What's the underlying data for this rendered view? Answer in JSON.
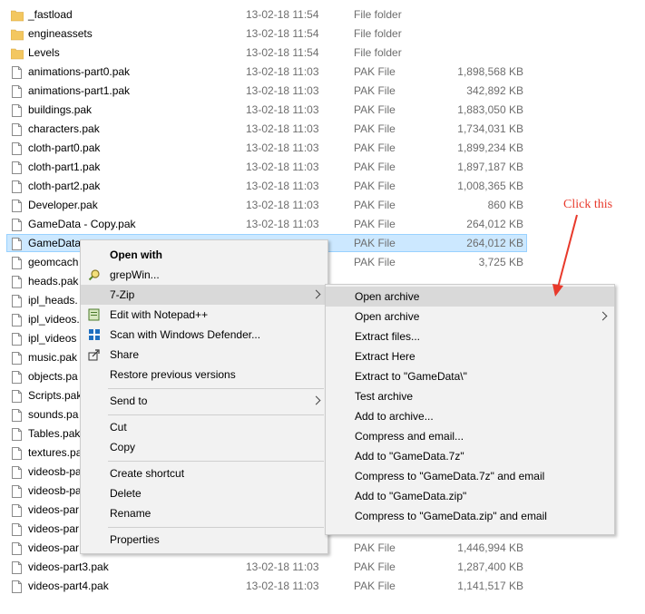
{
  "files": [
    {
      "name": "_fastload",
      "date": "13-02-18 11:54",
      "type": "File folder",
      "size": "",
      "kind": "folder"
    },
    {
      "name": "engineassets",
      "date": "13-02-18 11:54",
      "type": "File folder",
      "size": "",
      "kind": "folder"
    },
    {
      "name": "Levels",
      "date": "13-02-18 11:54",
      "type": "File folder",
      "size": "",
      "kind": "folder"
    },
    {
      "name": "animations-part0.pak",
      "date": "13-02-18 11:03",
      "type": "PAK File",
      "size": "1,898,568 KB",
      "kind": "file"
    },
    {
      "name": "animations-part1.pak",
      "date": "13-02-18 11:03",
      "type": "PAK File",
      "size": "342,892 KB",
      "kind": "file"
    },
    {
      "name": "buildings.pak",
      "date": "13-02-18 11:03",
      "type": "PAK File",
      "size": "1,883,050 KB",
      "kind": "file"
    },
    {
      "name": "characters.pak",
      "date": "13-02-18 11:03",
      "type": "PAK File",
      "size": "1,734,031 KB",
      "kind": "file"
    },
    {
      "name": "cloth-part0.pak",
      "date": "13-02-18 11:03",
      "type": "PAK File",
      "size": "1,899,234 KB",
      "kind": "file"
    },
    {
      "name": "cloth-part1.pak",
      "date": "13-02-18 11:03",
      "type": "PAK File",
      "size": "1,897,187 KB",
      "kind": "file"
    },
    {
      "name": "cloth-part2.pak",
      "date": "13-02-18 11:03",
      "type": "PAK File",
      "size": "1,008,365 KB",
      "kind": "file"
    },
    {
      "name": "Developer.pak",
      "date": "13-02-18 11:03",
      "type": "PAK File",
      "size": "860 KB",
      "kind": "file"
    },
    {
      "name": "GameData - Copy.pak",
      "date": "13-02-18 11:03",
      "type": "PAK File",
      "size": "264,012 KB",
      "kind": "file"
    },
    {
      "name": "GameData",
      "date": "",
      "type": "PAK File",
      "size": "264,012 KB",
      "kind": "file",
      "selected": true
    },
    {
      "name": "geomcach",
      "date": "",
      "type": "PAK File",
      "size": "3,725 KB",
      "kind": "file"
    },
    {
      "name": "heads.pak",
      "date": "",
      "type": "",
      "size": "",
      "kind": "file"
    },
    {
      "name": "ipl_heads.",
      "date": "",
      "type": "",
      "size": "",
      "kind": "file"
    },
    {
      "name": "ipl_videos.",
      "date": "",
      "type": "",
      "size": "",
      "kind": "file"
    },
    {
      "name": "ipl_videos",
      "date": "",
      "type": "",
      "size": "",
      "kind": "file"
    },
    {
      "name": "music.pak",
      "date": "",
      "type": "",
      "size": "",
      "kind": "file"
    },
    {
      "name": "objects.pa",
      "date": "",
      "type": "",
      "size": "",
      "kind": "file"
    },
    {
      "name": "Scripts.pak",
      "date": "",
      "type": "",
      "size": "",
      "kind": "file"
    },
    {
      "name": "sounds.pa",
      "date": "",
      "type": "",
      "size": "",
      "kind": "file"
    },
    {
      "name": "Tables.pak",
      "date": "",
      "type": "",
      "size": "",
      "kind": "file"
    },
    {
      "name": "textures.pa",
      "date": "",
      "type": "",
      "size": "",
      "kind": "file"
    },
    {
      "name": "videosb-pa",
      "date": "",
      "type": "",
      "size": "",
      "kind": "file"
    },
    {
      "name": "videosb-pa",
      "date": "",
      "type": "",
      "size": "",
      "kind": "file"
    },
    {
      "name": "videos-par",
      "date": "",
      "type": "",
      "size": "",
      "kind": "file"
    },
    {
      "name": "videos-par",
      "date": "",
      "type": "",
      "size": "",
      "kind": "file"
    },
    {
      "name": "videos-par",
      "date": "",
      "type": "PAK File",
      "size": "1,446,994 KB",
      "kind": "file"
    },
    {
      "name": "videos-part3.pak",
      "date": "13-02-18 11:03",
      "type": "PAK File",
      "size": "1,287,400 KB",
      "kind": "file"
    },
    {
      "name": "videos-part4.pak",
      "date": "13-02-18 11:03",
      "type": "PAK File",
      "size": "1,141,517 KB",
      "kind": "file"
    }
  ],
  "context_menu": {
    "open_with": "Open with",
    "grepwin": "grepWin...",
    "seven_zip": "7-Zip",
    "edit_notepad": "Edit with Notepad++",
    "scan_defender": "Scan with Windows Defender...",
    "share": "Share",
    "restore": "Restore previous versions",
    "send_to": "Send to",
    "cut": "Cut",
    "copy": "Copy",
    "create_shortcut": "Create shortcut",
    "delete": "Delete",
    "rename": "Rename",
    "properties": "Properties"
  },
  "submenu": {
    "items": [
      "Open archive",
      "Open archive",
      "Extract files...",
      "Extract Here",
      "Extract to \"GameData\\\"",
      "Test archive",
      "Add to archive...",
      "Compress and email...",
      "Add to \"GameData.7z\"",
      "Compress to \"GameData.7z\" and email",
      "Add to \"GameData.zip\"",
      "Compress to \"GameData.zip\" and email"
    ]
  },
  "annotation": {
    "text": "Click this",
    "color": "#e8392b"
  },
  "icons": {
    "folder": "folder-icon",
    "file": "file-icon",
    "grepwin": "magnifier-icon",
    "notepad": "notepad-icon",
    "defender": "shield-icon",
    "share": "share-icon"
  }
}
